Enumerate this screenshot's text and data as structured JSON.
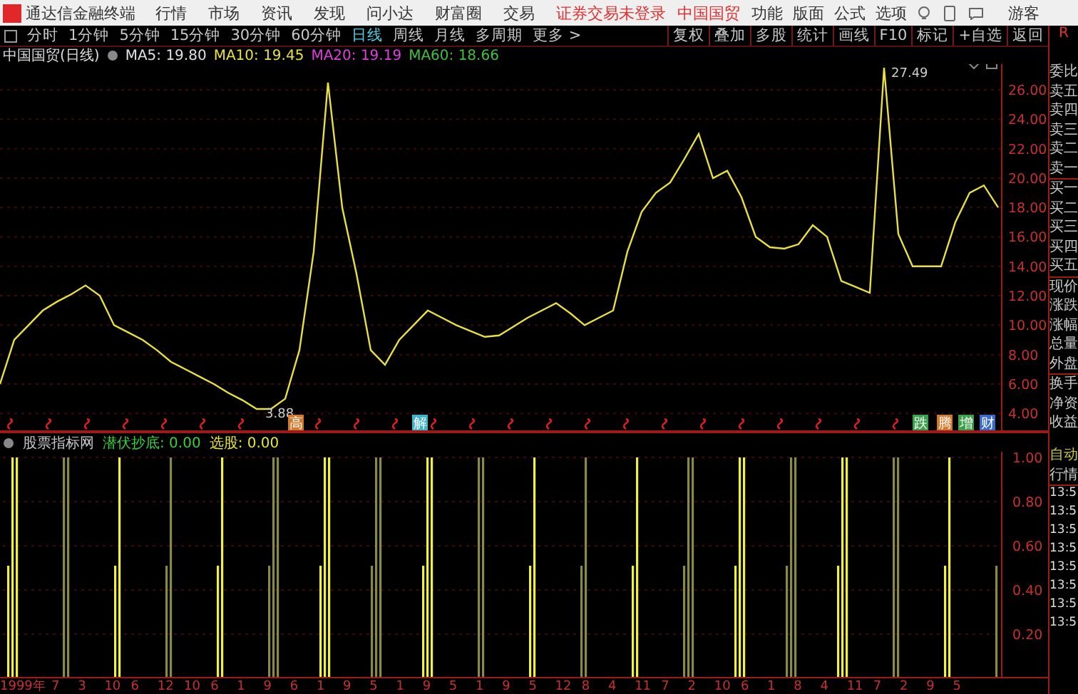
{
  "app_title": "通达信金融终端",
  "menu": [
    "行情",
    "市场",
    "资讯",
    "发现",
    "问小达",
    "财富圈",
    "交易"
  ],
  "login_status": "证券交易未登录",
  "stock_name": "中国国贸",
  "top_actions": [
    "功能",
    "版面",
    "公式",
    "选项"
  ],
  "user": "游客",
  "periods": [
    {
      "label": "分时",
      "selected": false
    },
    {
      "label": "1分钟",
      "selected": false
    },
    {
      "label": "5分钟",
      "selected": false
    },
    {
      "label": "15分钟",
      "selected": false
    },
    {
      "label": "30分钟",
      "selected": false
    },
    {
      "label": "60分钟",
      "selected": false
    },
    {
      "label": "日线",
      "selected": true
    },
    {
      "label": "周线",
      "selected": false
    },
    {
      "label": "月线",
      "selected": false
    },
    {
      "label": "多周期",
      "selected": false
    },
    {
      "label": "更多 >",
      "selected": false
    }
  ],
  "tools": [
    "复权",
    "叠加",
    "多股",
    "统计",
    "画线",
    "F10",
    "标记",
    "+自选",
    "返回"
  ],
  "chart": {
    "title": "中国国贸(日线)",
    "ma": [
      {
        "label": "MA5: 19.80",
        "color": "#e0e0e0"
      },
      {
        "label": "MA10: 19.45",
        "color": "#e8e040"
      },
      {
        "label": "MA20: 19.19",
        "color": "#e040e0"
      },
      {
        "label": "MA60: 18.66",
        "color": "#40c040"
      }
    ],
    "chart_data": {
      "type": "line",
      "grid": true,
      "ylim": [
        2.75,
        28
      ],
      "yticks": [
        {
          "value": 26,
          "label": "26.00"
        },
        {
          "value": 24,
          "label": "24.00"
        },
        {
          "value": 22,
          "label": "22.00"
        },
        {
          "value": 20,
          "label": "20.00"
        },
        {
          "value": 18,
          "label": "18.00"
        },
        {
          "value": 16,
          "label": "16.00"
        },
        {
          "value": 14,
          "label": "14.00"
        },
        {
          "value": 12,
          "label": "12.00"
        },
        {
          "value": 10,
          "label": "10.00"
        },
        {
          "value": 8,
          "label": "8.00"
        },
        {
          "value": 6,
          "label": "6.00"
        },
        {
          "value": 4,
          "label": "4.00"
        }
      ],
      "series": [
        {
          "color": "#e8e040",
          "values": [
            6,
            9,
            10,
            11,
            11.6,
            12.1,
            12.7,
            12,
            10,
            9.5,
            9,
            8.3,
            7.5,
            7,
            6.5,
            6,
            5.4,
            4.9,
            4.3,
            4.3,
            5,
            8.3,
            15,
            26.5,
            18,
            13.5,
            8.3,
            7.3,
            9,
            10,
            11,
            10.5,
            10,
            9.6,
            9.2,
            9.3,
            9.9,
            10.5,
            11,
            11.5,
            10.8,
            10,
            10.5,
            11,
            15,
            17.7,
            19,
            19.7,
            21.3,
            23,
            20,
            20.5,
            18.7,
            16,
            15.3,
            15.2,
            15.5,
            16.8,
            16,
            13,
            12.6,
            12.2,
            27.5,
            16.2,
            14,
            14,
            14,
            17,
            19,
            19.5,
            18
          ]
        }
      ]
    },
    "high_label": "27.49",
    "low_label": "3.88",
    "markers": [
      {
        "text": "高",
        "color": "#d07a30"
      },
      {
        "text": "解",
        "color": "#3fb4c8"
      },
      {
        "text": "跌",
        "color": "#3aa04a"
      },
      {
        "text": "腾",
        "color": "#d07a30"
      },
      {
        "text": "增",
        "color": "#3aa04a"
      },
      {
        "text": "财",
        "color": "#3a6ac8"
      }
    ]
  },
  "indicator": {
    "name": "股票指标网",
    "values": [
      {
        "label": "潜伏抄底: 0.00",
        "color": "#3ad13a"
      },
      {
        "label": "选股: 0.00",
        "color": "#e8e830"
      }
    ],
    "ticks": [
      "1.00",
      "0.80",
      "0.60",
      "0.40",
      "0.20"
    ]
  },
  "x_axis": [
    "1999年",
    "7",
    "3",
    "10",
    "6",
    "12",
    "10",
    "6",
    "1",
    "9",
    "6",
    "1",
    "9",
    "5",
    "1",
    "9",
    "5",
    "1",
    "9",
    "5",
    "12",
    "8",
    "4",
    "11",
    "7",
    "2",
    "10",
    "6",
    "1",
    "8",
    "4",
    "11",
    "7",
    "2",
    "9",
    "5"
  ],
  "side_panel": {
    "badge": "R",
    "quote_labels": [
      "委比",
      "卖五",
      "卖四",
      "卖三",
      "卖二",
      "卖一",
      "买一",
      "买二",
      "买三",
      "买四",
      "买五",
      "现价",
      "涨跌",
      "涨幅",
      "总量",
      "外盘",
      "换手",
      "净资",
      "收益"
    ],
    "mode": "自动",
    "section": "行情",
    "times": [
      "13:5",
      "13:5",
      "13:5",
      "13:5",
      "13:5",
      "13:5",
      "13:5",
      "13:5"
    ]
  }
}
